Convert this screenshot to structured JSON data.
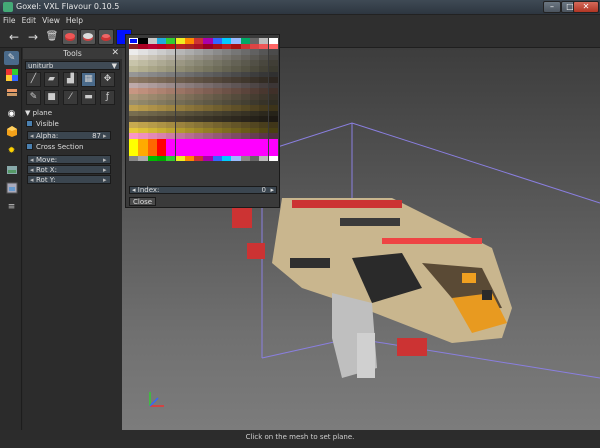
{
  "window": {
    "title": "Goxel: VXL Flavour 0.10.5",
    "controls": {
      "minimize": "–",
      "maximize": "□",
      "close": "✕"
    }
  },
  "menu": [
    "File",
    "Edit",
    "View",
    "Help"
  ],
  "toolbar": {
    "buttons": [
      "back-arrow-icon",
      "forward-arrow-icon",
      "trash-icon",
      "layer-red-icon",
      "layer-gray-icon",
      "layer-red-small-icon"
    ],
    "current_color": "#0010ff"
  },
  "left_rail": [
    "brush-icon",
    "palette-icon",
    "layers-icon",
    "eye-icon",
    "cube-icon",
    "sun-icon",
    "image-export-icon",
    "image-icon",
    "scripts-icon"
  ],
  "tools_panel": {
    "title": "Tools",
    "close": "✕",
    "brush_select": "uniturb",
    "tools_row1": [
      "pencil-icon",
      "cube-icon",
      "extrude-icon",
      "selection-icon",
      "move-icon"
    ],
    "tools_row2": [
      "paint-icon",
      "box-icon",
      "magic-wand-icon",
      "plane-icon",
      "procedural-icon"
    ],
    "plane_label": "plane",
    "visible_label": "Visible",
    "alpha_label": "Alpha:",
    "alpha_value": "87",
    "cross_section_label": "Cross Section",
    "move_label": "Move:",
    "rotx_label": "Rot X:",
    "roty_label": "Rot Y:"
  },
  "palette_popup": {
    "index_label": "Index:",
    "index_value": "0",
    "close_label": "Close"
  },
  "status": "Click on the mesh to set plane.",
  "colors": {
    "accent": "#4a80b0",
    "selected_color": "#0010ff",
    "plane_outline": "#8a7fe0"
  }
}
